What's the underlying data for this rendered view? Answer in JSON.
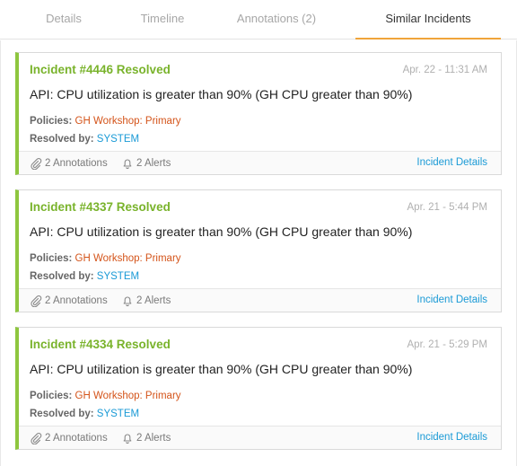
{
  "tabs": [
    {
      "label": "Details"
    },
    {
      "label": "Timeline"
    },
    {
      "label": "Annotations (2)"
    },
    {
      "label": "Similar Incidents"
    }
  ],
  "active_tab": "Similar Incidents",
  "accent_color": "#f0a43a",
  "resolved_color": "#79b32b",
  "incidents": [
    {
      "title": "Incident #4446 Resolved",
      "time": "Apr. 22 - 11:31 AM",
      "description": "API: CPU utilization is greater than 90% (GH CPU greater than 90%)",
      "policies_label": "Policies:",
      "policies_value": "GH Workshop: Primary",
      "resolved_label": "Resolved by:",
      "resolved_value": "SYSTEM",
      "annotations": "2 Annotations",
      "alerts": "2 Alerts",
      "details_link": "Incident Details"
    },
    {
      "title": "Incident #4337 Resolved",
      "time": "Apr. 21 - 5:44 PM",
      "description": "API: CPU utilization is greater than 90% (GH CPU greater than 90%)",
      "policies_label": "Policies:",
      "policies_value": "GH Workshop: Primary",
      "resolved_label": "Resolved by:",
      "resolved_value": "SYSTEM",
      "annotations": "2 Annotations",
      "alerts": "2 Alerts",
      "details_link": "Incident Details"
    },
    {
      "title": "Incident #4334 Resolved",
      "time": "Apr. 21 - 5:29 PM",
      "description": "API: CPU utilization is greater than 90% (GH CPU greater than 90%)",
      "policies_label": "Policies:",
      "policies_value": "GH Workshop: Primary",
      "resolved_label": "Resolved by:",
      "resolved_value": "SYSTEM",
      "annotations": "2 Annotations",
      "alerts": "2 Alerts",
      "details_link": "Incident Details"
    }
  ],
  "icons": {
    "annotations": "paperclip-icon",
    "alerts": "bell-icon"
  }
}
